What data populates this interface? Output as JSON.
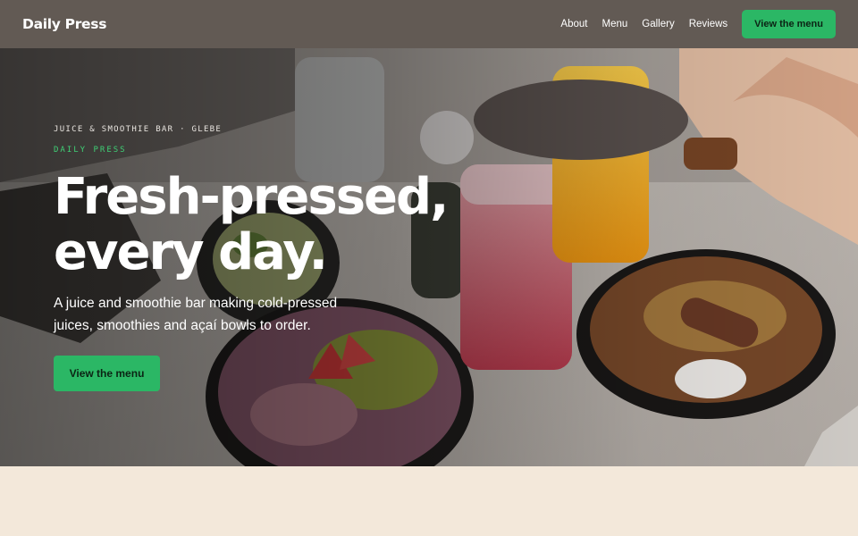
{
  "header": {
    "brand": "Daily Press",
    "nav": [
      "About",
      "Menu",
      "Gallery",
      "Reviews"
    ],
    "cta_label": "View the menu"
  },
  "hero": {
    "eyebrow": "JUICE & SMOOTHIE BAR · GLEBE",
    "tagline": "DAILY PRESS",
    "headline_line1": "Fresh-pressed,",
    "headline_line2": "every day.",
    "lede": "A juice and smoothie bar making cold-pressed juices, smoothies and açaí bowls to order.",
    "cta_label": "View the menu"
  },
  "colors": {
    "header_bg": "#625a54",
    "accent_green": "#2bb765",
    "tagline_green": "#3fcf75",
    "page_bg": "#f3e8da"
  }
}
